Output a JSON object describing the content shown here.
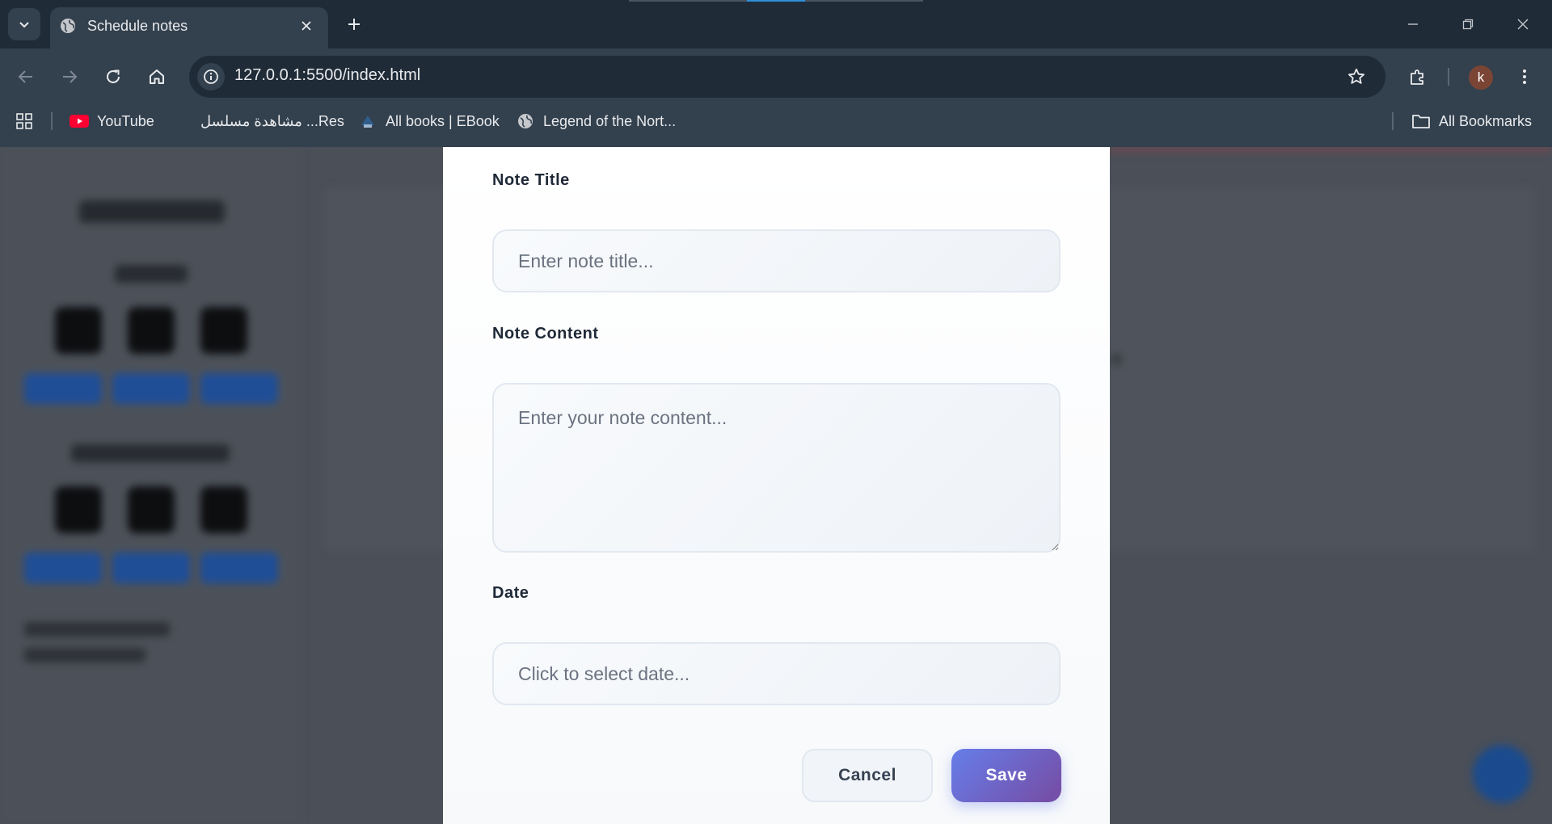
{
  "browser": {
    "tab": {
      "title": "Schedule notes",
      "favicon": "globe-icon"
    },
    "address_bar": {
      "url": "127.0.0.1:5500/index.html"
    },
    "profile": {
      "initial": "k",
      "color": "#7b4536"
    },
    "bookmarks": [
      {
        "label": "YouTube",
        "icon": "youtube-icon"
      },
      {
        "label": "مشاهدة مسلسل ...Res",
        "icon": "bookmark-favicon"
      },
      {
        "label": "All books | EBook",
        "icon": "ebook-icon"
      },
      {
        "label": "Legend of the Nort...",
        "icon": "globe-icon"
      }
    ],
    "all_bookmarks_label": "All Bookmarks"
  },
  "modal": {
    "title_field": {
      "label": "Note Title",
      "placeholder": "Enter note title...",
      "value": ""
    },
    "content_field": {
      "label": "Note Content",
      "placeholder": "Enter your note content...",
      "value": ""
    },
    "date_field": {
      "label": "Date",
      "placeholder": "Click to select date...",
      "value": ""
    },
    "cancel_label": "Cancel",
    "save_label": "Save"
  },
  "colors": {
    "save_gradient_start": "#667eea",
    "save_gradient_end": "#764ba2",
    "overlay_background": "#4a4f58"
  }
}
